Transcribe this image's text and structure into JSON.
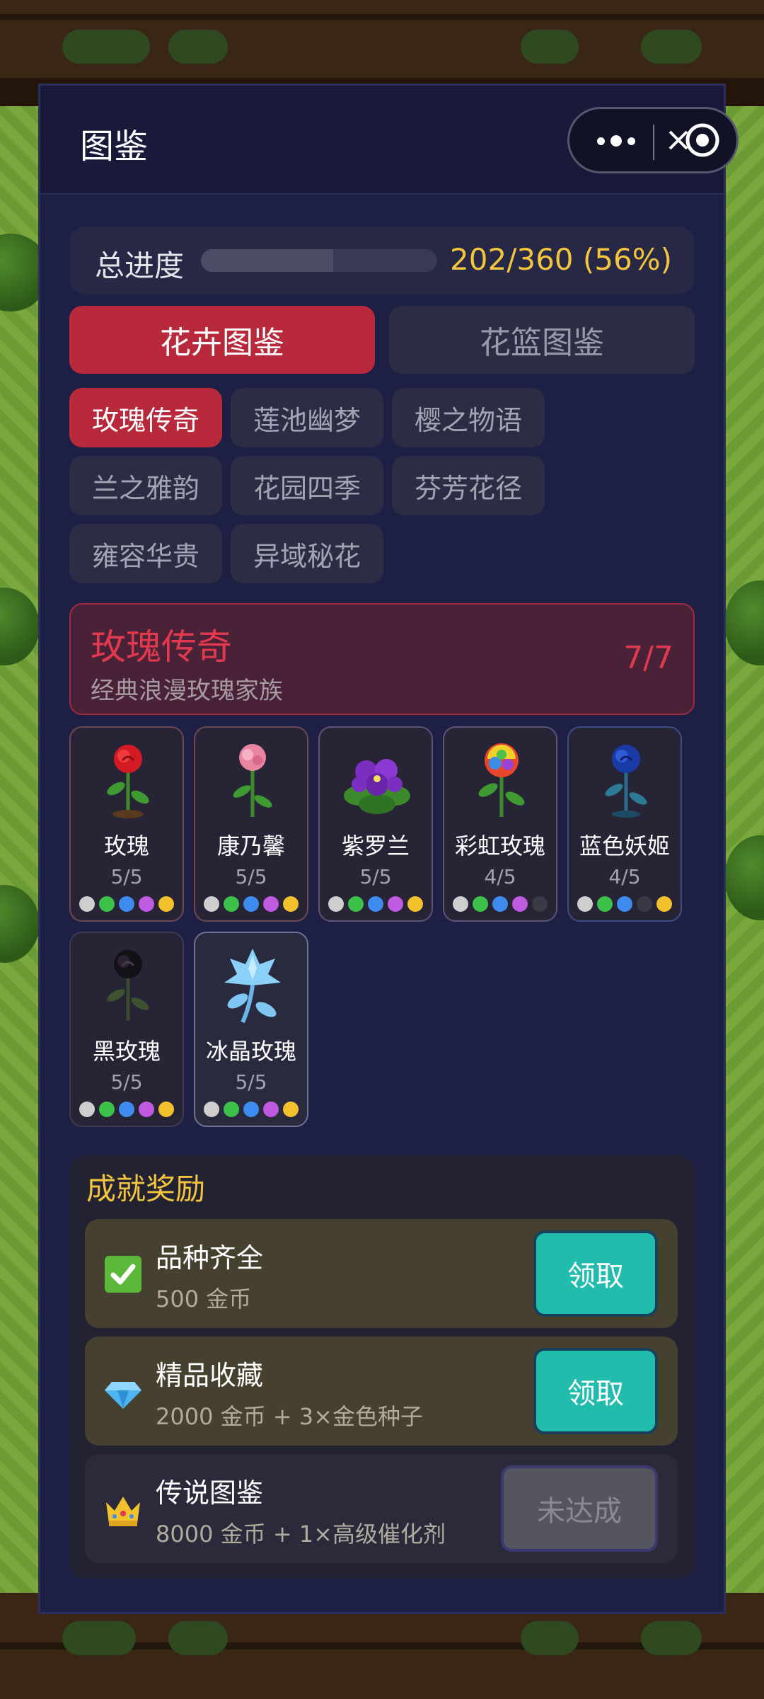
{
  "panel": {
    "title": "图鉴"
  },
  "progress": {
    "label": "总进度",
    "text": "202/360 (56%)",
    "fraction": 0.56
  },
  "main_tabs": [
    {
      "label": "花卉图鉴",
      "active": true
    },
    {
      "label": "花篮图鉴",
      "active": false
    }
  ],
  "categories": [
    {
      "label": "玫瑰传奇",
      "active": true
    },
    {
      "label": "莲池幽梦",
      "active": false
    },
    {
      "label": "樱之物语",
      "active": false
    },
    {
      "label": "兰之雅韵",
      "active": false
    },
    {
      "label": "花园四季",
      "active": false
    },
    {
      "label": "芬芳花径",
      "active": false
    },
    {
      "label": "雍容华贵",
      "active": false
    },
    {
      "label": "异域秘花",
      "active": false
    }
  ],
  "series": {
    "name": "玫瑰传奇",
    "desc": "经典浪漫玫瑰家族",
    "count": "7/7"
  },
  "rarity_colors": [
    "#cfcfcf",
    "#3cc24b",
    "#3f8cf0",
    "#c05ae0",
    "#f3c02e"
  ],
  "empty_dot_color": "#3a3a44",
  "flowers": [
    {
      "name": "玫瑰",
      "progress": "5/5",
      "dots": [
        1,
        1,
        1,
        1,
        1
      ],
      "icon": "red-rose-icon"
    },
    {
      "name": "康乃馨",
      "progress": "5/5",
      "dots": [
        1,
        1,
        1,
        1,
        1
      ],
      "icon": "carnation-icon"
    },
    {
      "name": "紫罗兰",
      "progress": "5/5",
      "dots": [
        1,
        1,
        1,
        1,
        1
      ],
      "icon": "violet-icon"
    },
    {
      "name": "彩虹玫瑰",
      "progress": "4/5",
      "dots": [
        1,
        1,
        1,
        1,
        0
      ],
      "icon": "rainbow-rose-icon"
    },
    {
      "name": "蓝色妖姬",
      "progress": "4/5",
      "dots": [
        1,
        1,
        1,
        0,
        1
      ],
      "icon": "blue-rose-icon"
    },
    {
      "name": "黑玫瑰",
      "progress": "5/5",
      "dots": [
        1,
        1,
        1,
        1,
        1
      ],
      "icon": "black-rose-icon"
    },
    {
      "name": "冰晶玫瑰",
      "progress": "5/5",
      "dots": [
        1,
        1,
        1,
        1,
        1
      ],
      "icon": "ice-rose-icon"
    }
  ],
  "achievements": {
    "title": "成就奖励",
    "items": [
      {
        "name": "品种齐全",
        "reward": "500 金币",
        "button": "领取",
        "icon": "checkmark-icon"
      },
      {
        "name": "精品收藏",
        "reward": "2000 金币 + 3×金色种子",
        "button": "领取",
        "icon": "diamond-icon"
      },
      {
        "name": "传说图鉴",
        "reward": "8000 金币 + 1×高级催化剂",
        "button": "未达成",
        "icon": "crown-icon"
      }
    ]
  }
}
